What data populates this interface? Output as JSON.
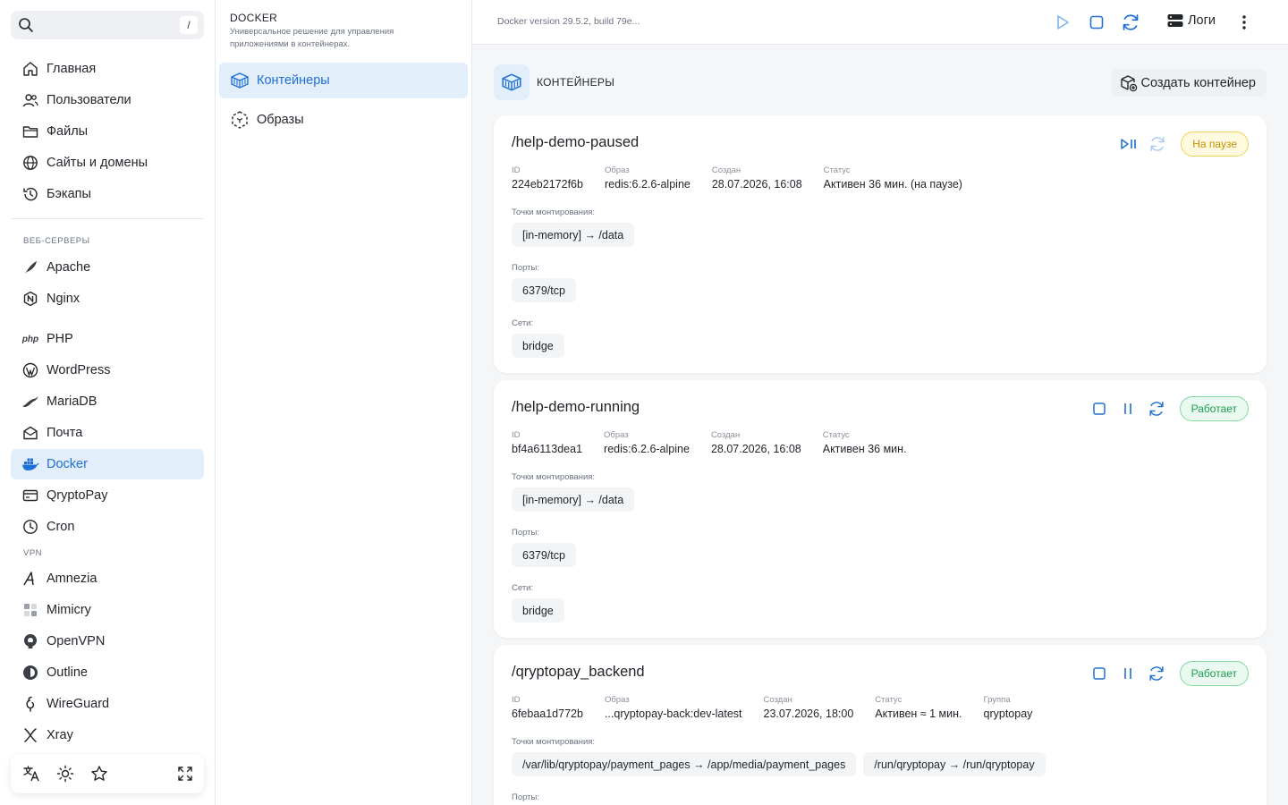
{
  "sidebar": {
    "search_kbd": "/",
    "items_main": [
      {
        "label": "Главная",
        "icon": "home-icon"
      },
      {
        "label": "Пользователи",
        "icon": "users-icon"
      },
      {
        "label": "Файлы",
        "icon": "folder-icon"
      },
      {
        "label": "Сайты и домены",
        "icon": "globe-icon"
      },
      {
        "label": "Бэкапы",
        "icon": "history-icon"
      }
    ],
    "section_web": "ВЕБ-СЕРВЕРЫ",
    "items_web": [
      {
        "label": "Apache",
        "icon": "feather-icon"
      },
      {
        "label": "Nginx",
        "icon": "nginx-icon"
      },
      {
        "label": "PHP",
        "icon": "php-icon",
        "icon_text": "php"
      },
      {
        "label": "WordPress",
        "icon": "wordpress-icon"
      },
      {
        "label": "MariaDB",
        "icon": "mariadb-icon"
      },
      {
        "label": "Почта",
        "icon": "mail-icon"
      },
      {
        "label": "Docker",
        "icon": "docker-icon"
      },
      {
        "label": "QryptoPay",
        "icon": "card-icon"
      },
      {
        "label": "Cron",
        "icon": "clock-icon"
      }
    ],
    "section_vpn": "VPN",
    "items_vpn": [
      {
        "label": "Amnezia",
        "icon": "amnezia-icon"
      },
      {
        "label": "Mimicry",
        "icon": "mimicry-icon"
      },
      {
        "label": "OpenVPN",
        "icon": "openvpn-icon"
      },
      {
        "label": "Outline",
        "icon": "outline-icon"
      },
      {
        "label": "WireGuard",
        "icon": "wireguard-icon"
      },
      {
        "label": "Xray",
        "icon": "xray-icon"
      }
    ],
    "active": "Docker"
  },
  "subnav": {
    "title": "DOCKER",
    "description": "Универсальное решение для управления приложениями в контейнерах.",
    "items": [
      {
        "label": "Контейнеры",
        "icon": "container-icon"
      },
      {
        "label": "Образы",
        "icon": "image-icon"
      }
    ]
  },
  "topbar": {
    "version": "Docker version 29.5.2, build 79e...",
    "logs_label": "Логи"
  },
  "main": {
    "section_title": "КОНТЕЙНЕРЫ",
    "create_label": "Создать контейнер"
  },
  "labels": {
    "id": "ID",
    "image": "Образ",
    "created": "Создан",
    "status": "Статус",
    "group": "Группа",
    "mounts": "Точки монтирования:",
    "ports": "Порты:",
    "networks": "Сети:"
  },
  "containers": [
    {
      "name": "/help-demo-paused",
      "state": "На паузе",
      "id": "224eb2172f6b",
      "image": "redis:6.2.6-alpine",
      "created": "28.07.2026, 16:08",
      "status": "Активен 36 мин. (на паузе)",
      "mounts": [
        "[in-memory] → /data"
      ],
      "ports": [
        "6379/tcp"
      ],
      "networks": [
        "bridge"
      ]
    },
    {
      "name": "/help-demo-running",
      "state": "Работает",
      "id": "bf4a6113dea1",
      "image": "redis:6.2.6-alpine",
      "created": "28.07.2026, 16:08",
      "status": "Активен 36 мин.",
      "mounts": [
        "[in-memory] → /data"
      ],
      "ports": [
        "6379/tcp"
      ],
      "networks": [
        "bridge"
      ]
    },
    {
      "name": "/qryptopay_backend",
      "state": "Работает",
      "id": "6febaa1d772b",
      "image": "...qryptopay-back:dev-latest",
      "created": "23.07.2026, 18:00",
      "status": "Активен ≈ 1 мин.",
      "group": "qryptopay",
      "mounts": [
        "/var/lib/qryptopay/payment_pages → /app/media/payment_pages",
        "/run/qryptopay → /run/qryptopay"
      ]
    }
  ]
}
